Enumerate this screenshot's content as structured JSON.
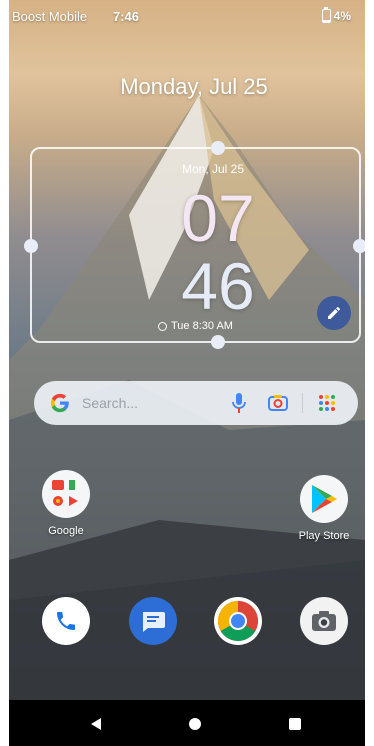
{
  "status_bar": {
    "carrier": "Boost Mobile",
    "time": "7:46",
    "battery": "4%"
  },
  "home": {
    "date_big": "Monday, Jul 25"
  },
  "clock_widget": {
    "date": "Mon, Jul 25",
    "hour": "07",
    "minute": "46",
    "alarm": "Tue 8:30 AM"
  },
  "search": {
    "placeholder": "Search..."
  },
  "apps": [
    {
      "label": "Google"
    },
    {
      "label": "Play Store"
    }
  ],
  "dock": [
    "phone-icon",
    "messages-icon",
    "chrome-icon",
    "camera-icon"
  ],
  "colors": {
    "edit_button": "#3f5a9a",
    "messages_blue": "#2d6ed6",
    "google_blue": "#4285f4",
    "google_red": "#ea4335",
    "google_yellow": "#fbbc05",
    "google_green": "#34a853"
  }
}
